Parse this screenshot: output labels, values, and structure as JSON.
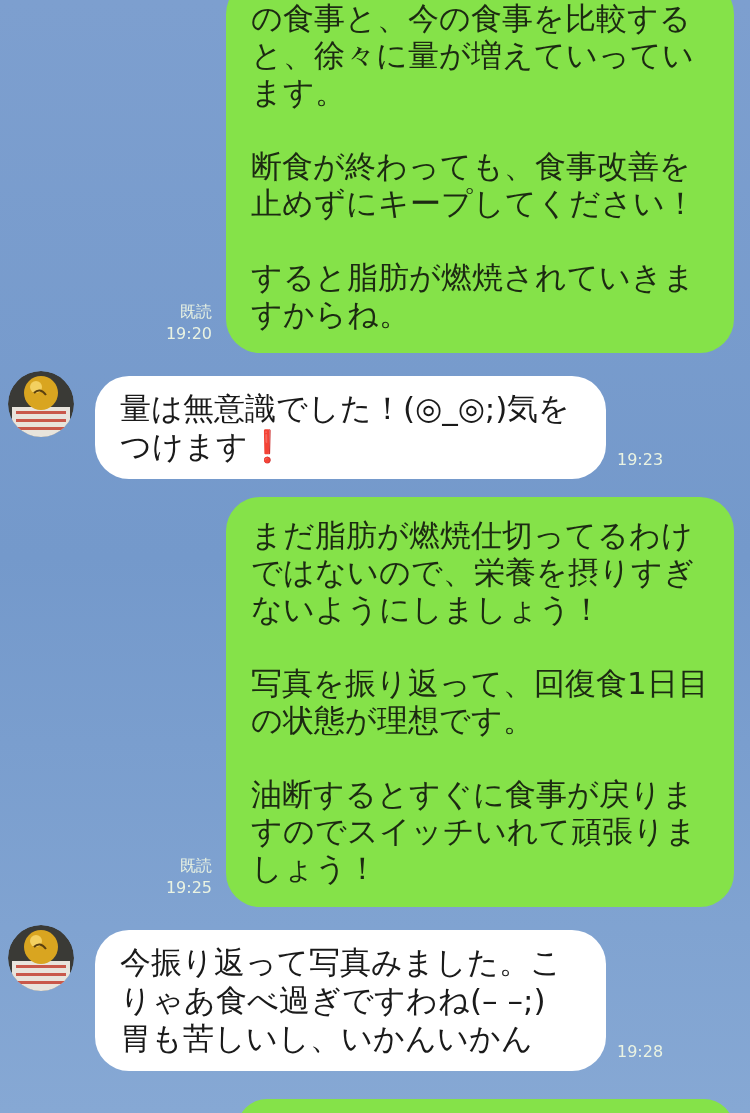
{
  "messages": [
    {
      "kind": "sent",
      "paragraphs": [
        "の食事と、今の食事を比較すると、徐々に量が増えていっています。",
        "断食が終わっても、食事改善を止めずにキープしてください！",
        "すると脂肪が燃焼されていきますからね。"
      ],
      "read": "既読",
      "time": "19:20"
    },
    {
      "kind": "received",
      "paragraphs": [
        "量は無意識でした！(◎_◎;)気をつけます❗"
      ],
      "time": "19:23"
    },
    {
      "kind": "sent",
      "paragraphs": [
        "まだ脂肪が燃焼仕切ってるわけではないので、栄養を摂りすぎないようにしましょう！",
        "写真を振り返って、回復食1日目の状態が理想です。",
        "油断するとすぐに食事が戻りますのでスイッチいれて頑張りましょう！"
      ],
      "read": "既読",
      "time": "19:25"
    },
    {
      "kind": "received",
      "paragraphs": [
        "今振り返って写真みました。こりゃあ食べ過ぎですわね(– –;)胃も苦しいし、いかんいかん"
      ],
      "time": "19:28"
    },
    {
      "kind": "sent_partial"
    }
  ]
}
